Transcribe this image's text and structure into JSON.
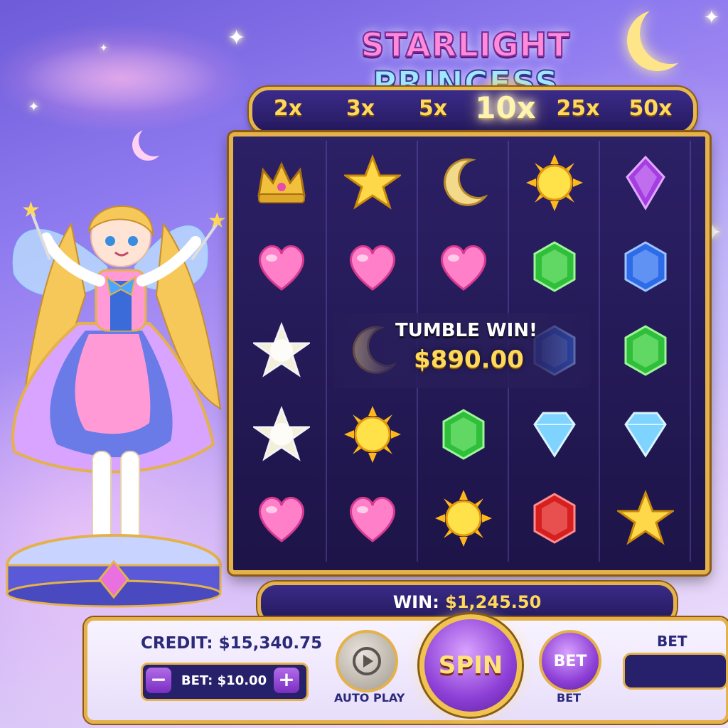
{
  "game": {
    "title_part1": "STARLIGHT",
    "title_part2": "PRINCESS"
  },
  "multipliers": [
    "2x",
    "3x",
    "5x",
    "10x",
    "25x",
    "50x"
  ],
  "active_multiplier": "10x",
  "reels": [
    [
      "crown",
      "pink-heart",
      "star-burst",
      "star-burst",
      "pink-heart"
    ],
    [
      "gold-star",
      "pink-heart",
      "moon",
      "sun",
      "pink-heart"
    ],
    [
      "moon",
      "pink-heart",
      "",
      "green-gem",
      "sun"
    ],
    [
      "sun",
      "green-gem",
      "blue-gem",
      "diamond",
      "red-gem"
    ],
    [
      "purple-gem",
      "blue-gem",
      "green-gem",
      "diamond",
      "gold-star"
    ]
  ],
  "tumble": {
    "label": "TUMBLE WIN!",
    "amount": "$890.00"
  },
  "win": {
    "label": "WIN:",
    "amount": "$1,245.50"
  },
  "credit": {
    "label": "CREDIT:",
    "amount": "$15,340.75"
  },
  "bet_control": {
    "minus": "−",
    "plus": "+",
    "label": "BET: $10.00"
  },
  "buttons": {
    "autoplay": "AUTO PLAY",
    "spin": "SPIN",
    "bet_round": "BET",
    "bet_round_caption": "BET",
    "bet_box_label": "BET"
  },
  "colors": {
    "gold": "#e4b14a",
    "navy": "#27206a",
    "purple": "#8d3fd6",
    "accent_yellow": "#ffd95a"
  },
  "icons": {
    "character": "princess-character",
    "autoplay": "play-icon"
  }
}
